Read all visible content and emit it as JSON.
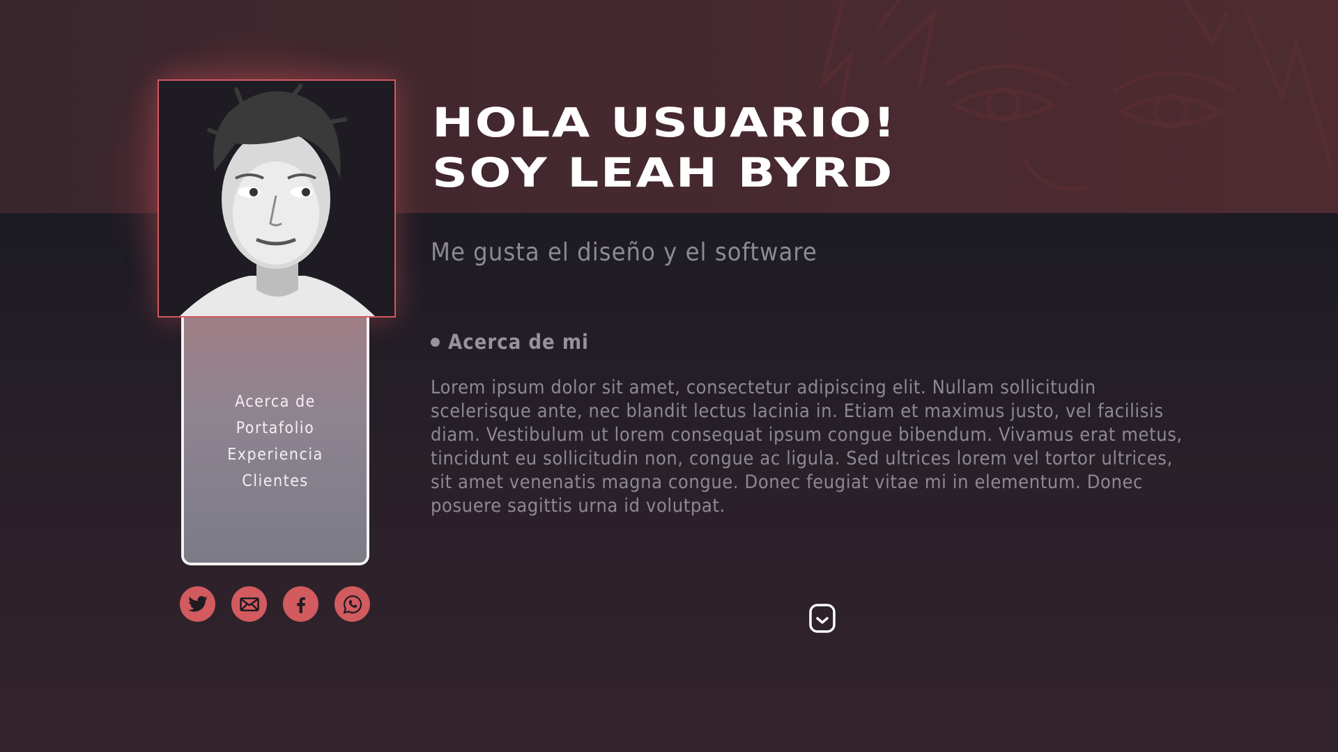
{
  "header": {
    "title_line1": "HOLA USUARIO!",
    "title_line2": "SOY LEAH BYRD",
    "subtitle": "Me gusta el diseño y el software"
  },
  "profile": {
    "photo": "portrait-photo"
  },
  "nav": {
    "items": [
      {
        "label": "Acerca de"
      },
      {
        "label": "Portafolio"
      },
      {
        "label": "Experiencia"
      },
      {
        "label": "Clientes"
      }
    ]
  },
  "social": [
    {
      "icon": "twitter-icon"
    },
    {
      "icon": "mail-icon"
    },
    {
      "icon": "facebook-icon"
    },
    {
      "icon": "whatsapp-icon"
    }
  ],
  "about": {
    "heading": "Acerca de mi",
    "body": "Lorem ipsum dolor sit amet, consectetur adipiscing elit. Nullam sollicitudin scelerisque ante, nec blandit lectus lacinia in. Etiam et maximus justo, vel facilisis diam. Vestibulum ut lorem consequat ipsum congue bibendum. Vivamus erat metus, tincidunt eu sollicitudin non, congue ac ligula. Sed ultrices lorem vel tortor ultrices, sit amet venenatis magna congue. Donec feugiat vitae mi in elementum. Donec posuere sagittis urna id volutpat."
  },
  "scroll": {
    "icon": "chevron-down-icon"
  },
  "colors": {
    "accent": "#d15b5f",
    "background": "#1d1b24",
    "hero_band": "#45292f",
    "nav_card": "#7b7b86",
    "text_muted": "#8c8993"
  }
}
